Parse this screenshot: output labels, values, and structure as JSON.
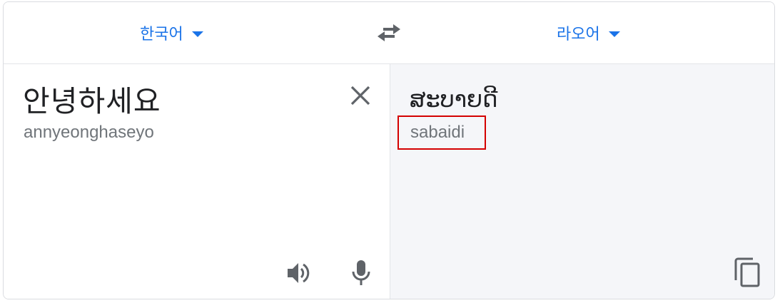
{
  "source_language": {
    "label": "한국어",
    "icon": "chevron-down-icon"
  },
  "target_language": {
    "label": "라오어",
    "icon": "chevron-down-icon"
  },
  "swap": {
    "icon": "swap-arrows-icon"
  },
  "source": {
    "text": "안녕하세요",
    "transliteration": "annyeonghaseyo",
    "clear_icon": "close-icon",
    "listen_icon": "speaker-icon",
    "mic_icon": "microphone-icon"
  },
  "target": {
    "text": "ສະບາຍດີ",
    "transliteration": "sabaidi",
    "copy_icon": "copy-icon"
  },
  "colors": {
    "accent": "#1a73e8",
    "text_primary": "#202124",
    "text_secondary": "#70757a",
    "icon": "#5f6368",
    "target_background": "#f5f6f9",
    "highlight": "#d40000"
  }
}
